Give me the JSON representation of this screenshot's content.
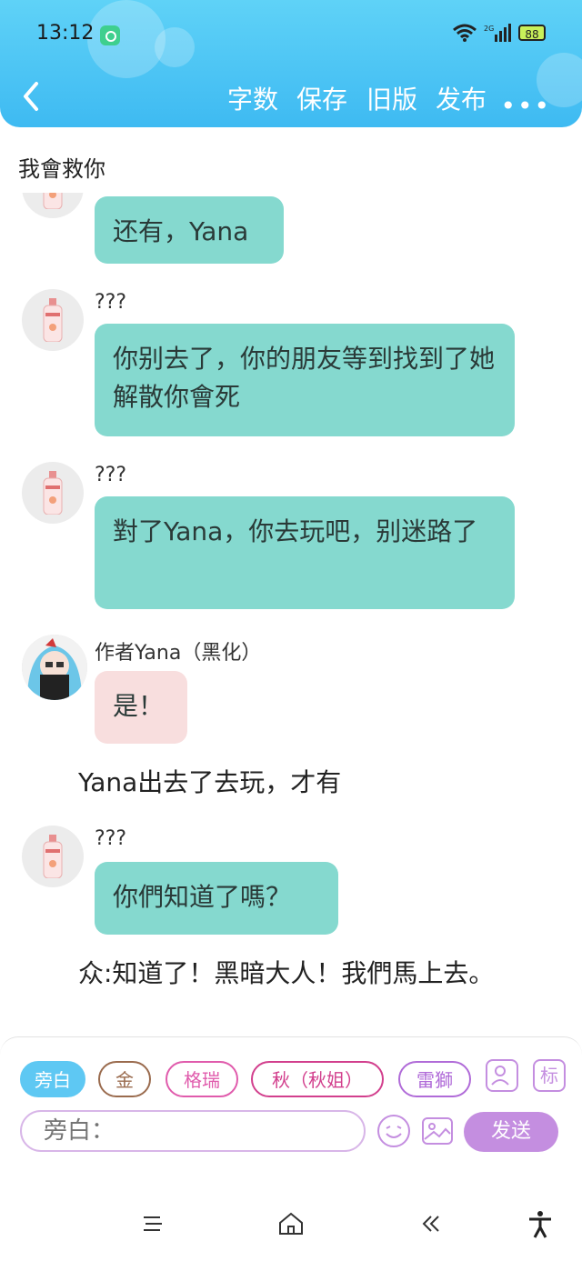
{
  "status_bar": {
    "time": "13:12",
    "network": "2G",
    "battery": "88"
  },
  "toolbar": {
    "word_count": "字数",
    "save": "保存",
    "old_version": "旧版",
    "publish": "发布",
    "more": "•••"
  },
  "chapter": {
    "title": "我會救你"
  },
  "messages": [
    {
      "name": "",
      "text": "还有，Yana"
    },
    {
      "name": "???",
      "text": "你别去了，你的朋友等到找到了她解散你會死"
    },
    {
      "name": "???",
      "text": "對了Yana，你去玩吧，别迷路了"
    },
    {
      "name": "作者Yana（黑化）",
      "text": "是！"
    },
    {
      "narration": "Yana出去了去玩，才有"
    },
    {
      "name": "???",
      "text": "你們知道了嗎？"
    },
    {
      "narration": "众:知道了！黑暗大人！我們馬上去。"
    }
  ],
  "input_panel": {
    "characters": [
      "旁白",
      "金",
      "格瑞",
      "秋（秋姐）",
      "雷獅"
    ],
    "role_icon_label": "标",
    "input_placeholder": "旁白：",
    "send_label": "发送"
  },
  "colors": {
    "header": "#3ebaf2",
    "bubble_teal": "#85d9cf",
    "bubble_pink": "#f8dede",
    "accent_purple": "#c48ee0"
  }
}
